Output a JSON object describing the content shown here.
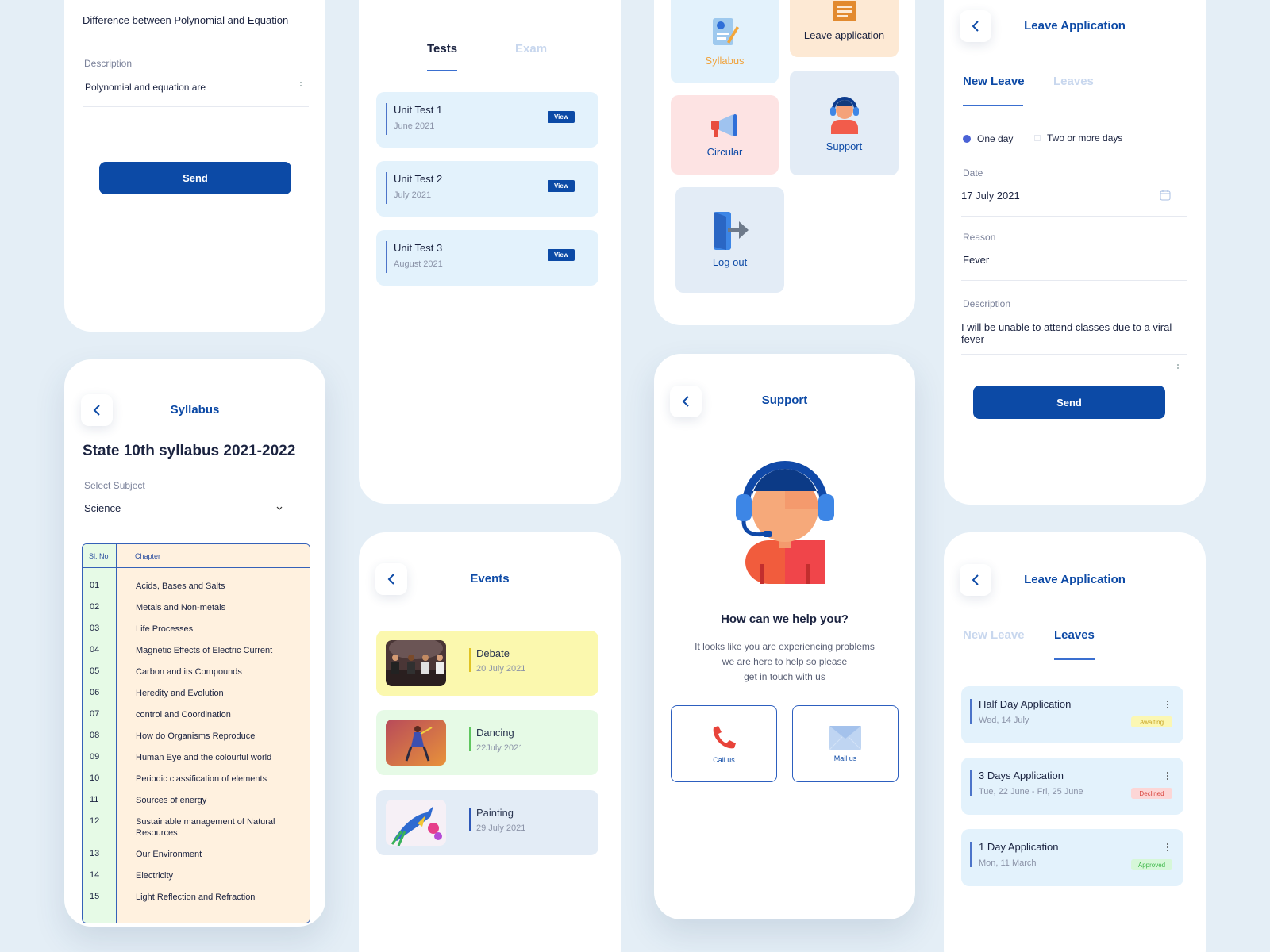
{
  "colors": {
    "background": "#e4eef6",
    "primary": "#0c4aa6",
    "accent_blue": "#0d4aa6"
  },
  "query_form": {
    "title_value": "Difference between Polynomial and Equation",
    "description_label": "Description",
    "description_value": "Polynomial and equation are",
    "send_label": "Send"
  },
  "tests": {
    "tabs": [
      "Tests",
      "Exam"
    ],
    "items": [
      {
        "title": "Unit Test 1",
        "date": "June 2021",
        "action": "View"
      },
      {
        "title": "Unit Test 2",
        "date": "July 2021",
        "action": "View"
      },
      {
        "title": "Unit Test 3",
        "date": "August 2021",
        "action": "View"
      }
    ]
  },
  "menu": {
    "tiles": [
      {
        "label": "Syllabus",
        "icon": "syllabus-icon"
      },
      {
        "label": "Leave application",
        "icon": "leave-application-icon"
      },
      {
        "label": "Circular",
        "icon": "megaphone-icon"
      },
      {
        "label": "Support",
        "icon": "support-agent-icon"
      },
      {
        "label": "Log out",
        "icon": "logout-icon"
      }
    ]
  },
  "leave_new": {
    "title": "Leave Application",
    "tabs": [
      "New Leave",
      "Leaves"
    ],
    "options": [
      "One day",
      "Two or more days"
    ],
    "date_label": "Date",
    "date_value": "17 July 2021",
    "reason_label": "Reason",
    "reason_value": "Fever",
    "description_label": "Description",
    "description_value": "I will be unable to attend classes due to a viral fever",
    "send_label": "Send"
  },
  "syllabus": {
    "title": "Syllabus",
    "heading": "State 10th syllabus 2021-2022",
    "select_label": "Select Subject",
    "select_value": "Science",
    "columns": [
      "Sl. No",
      "Chapter"
    ],
    "rows": [
      {
        "no": "01",
        "chapter": "Acids, Bases and Salts"
      },
      {
        "no": "02",
        "chapter": "Metals and Non-metals"
      },
      {
        "no": "03",
        "chapter": "Life Processes"
      },
      {
        "no": "04",
        "chapter": "Magnetic Effects of Electric Current"
      },
      {
        "no": "05",
        "chapter": "Carbon and its Compounds"
      },
      {
        "no": "06",
        "chapter": "Heredity and Evolution"
      },
      {
        "no": "07",
        "chapter": "control and Coordination"
      },
      {
        "no": "08",
        "chapter": "How do Organisms Reproduce"
      },
      {
        "no": "09",
        "chapter": "Human Eye and the colourful world"
      },
      {
        "no": "10",
        "chapter": "Periodic classification of elements"
      },
      {
        "no": "11",
        "chapter": "Sources of energy"
      },
      {
        "no": "12",
        "chapter": "Sustainable management of Natural Resources"
      },
      {
        "no": "13",
        "chapter": "Our Environment"
      },
      {
        "no": "14",
        "chapter": "Electricity"
      },
      {
        "no": "15",
        "chapter": "Light Reflection and Refraction"
      }
    ]
  },
  "events": {
    "title": "Events",
    "items": [
      {
        "title": "Debate",
        "date": "20 July 2021",
        "color": "#fbf8ae",
        "bar": "#e0c323"
      },
      {
        "title": "Dancing",
        "date": "22July 2021",
        "color": "#e6fae6",
        "bar": "#5fc65f"
      },
      {
        "title": "Painting",
        "date": "29 July 2021",
        "color": "#e3ecf6",
        "bar": "#2e58b8"
      }
    ]
  },
  "support": {
    "title": "Support",
    "heading": "How can we help you?",
    "message_lines": [
      "It looks like you are experiencing problems",
      "we are here to help so please",
      "get in touch with us"
    ],
    "call_label": "Call us",
    "mail_label": "Mail us"
  },
  "leaves_list": {
    "title": "Leave Application",
    "tabs": [
      "New Leave",
      "Leaves"
    ],
    "items": [
      {
        "title": "Half Day Application",
        "date": "Wed, 14 July",
        "status": "Awaiting",
        "status_bg": "#fbf7b3",
        "status_fg": "#c7a324"
      },
      {
        "title": "3 Days Application",
        "date": "Tue, 22 June - Fri, 25 June",
        "status": "Declined",
        "status_bg": "#fcd6d6",
        "status_fg": "#d8453f"
      },
      {
        "title": "1 Day Application",
        "date": "Mon, 11 March",
        "status": "Approved",
        "status_bg": "#d6f7d8",
        "status_fg": "#3fb84a"
      }
    ]
  }
}
